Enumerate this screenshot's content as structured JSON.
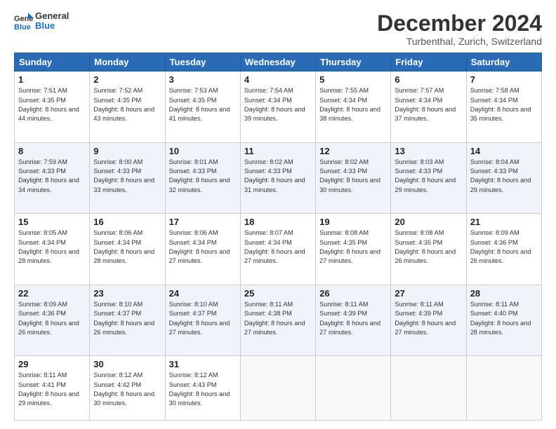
{
  "header": {
    "logo_line1": "General",
    "logo_line2": "Blue",
    "month_title": "December 2024",
    "location": "Turbenthal, Zurich, Switzerland"
  },
  "days_of_week": [
    "Sunday",
    "Monday",
    "Tuesday",
    "Wednesday",
    "Thursday",
    "Friday",
    "Saturday"
  ],
  "weeks": [
    [
      {
        "day": "1",
        "sunrise": "Sunrise: 7:51 AM",
        "sunset": "Sunset: 4:35 PM",
        "daylight": "Daylight: 8 hours and 44 minutes."
      },
      {
        "day": "2",
        "sunrise": "Sunrise: 7:52 AM",
        "sunset": "Sunset: 4:35 PM",
        "daylight": "Daylight: 8 hours and 43 minutes."
      },
      {
        "day": "3",
        "sunrise": "Sunrise: 7:53 AM",
        "sunset": "Sunset: 4:35 PM",
        "daylight": "Daylight: 8 hours and 41 minutes."
      },
      {
        "day": "4",
        "sunrise": "Sunrise: 7:54 AM",
        "sunset": "Sunset: 4:34 PM",
        "daylight": "Daylight: 8 hours and 39 minutes."
      },
      {
        "day": "5",
        "sunrise": "Sunrise: 7:55 AM",
        "sunset": "Sunset: 4:34 PM",
        "daylight": "Daylight: 8 hours and 38 minutes."
      },
      {
        "day": "6",
        "sunrise": "Sunrise: 7:57 AM",
        "sunset": "Sunset: 4:34 PM",
        "daylight": "Daylight: 8 hours and 37 minutes."
      },
      {
        "day": "7",
        "sunrise": "Sunrise: 7:58 AM",
        "sunset": "Sunset: 4:34 PM",
        "daylight": "Daylight: 8 hours and 35 minutes."
      }
    ],
    [
      {
        "day": "8",
        "sunrise": "Sunrise: 7:59 AM",
        "sunset": "Sunset: 4:33 PM",
        "daylight": "Daylight: 8 hours and 34 minutes."
      },
      {
        "day": "9",
        "sunrise": "Sunrise: 8:00 AM",
        "sunset": "Sunset: 4:33 PM",
        "daylight": "Daylight: 8 hours and 33 minutes."
      },
      {
        "day": "10",
        "sunrise": "Sunrise: 8:01 AM",
        "sunset": "Sunset: 4:33 PM",
        "daylight": "Daylight: 8 hours and 32 minutes."
      },
      {
        "day": "11",
        "sunrise": "Sunrise: 8:02 AM",
        "sunset": "Sunset: 4:33 PM",
        "daylight": "Daylight: 8 hours and 31 minutes."
      },
      {
        "day": "12",
        "sunrise": "Sunrise: 8:02 AM",
        "sunset": "Sunset: 4:33 PM",
        "daylight": "Daylight: 8 hours and 30 minutes."
      },
      {
        "day": "13",
        "sunrise": "Sunrise: 8:03 AM",
        "sunset": "Sunset: 4:33 PM",
        "daylight": "Daylight: 8 hours and 29 minutes."
      },
      {
        "day": "14",
        "sunrise": "Sunrise: 8:04 AM",
        "sunset": "Sunset: 4:33 PM",
        "daylight": "Daylight: 8 hours and 29 minutes."
      }
    ],
    [
      {
        "day": "15",
        "sunrise": "Sunrise: 8:05 AM",
        "sunset": "Sunset: 4:34 PM",
        "daylight": "Daylight: 8 hours and 28 minutes."
      },
      {
        "day": "16",
        "sunrise": "Sunrise: 8:06 AM",
        "sunset": "Sunset: 4:34 PM",
        "daylight": "Daylight: 8 hours and 28 minutes."
      },
      {
        "day": "17",
        "sunrise": "Sunrise: 8:06 AM",
        "sunset": "Sunset: 4:34 PM",
        "daylight": "Daylight: 8 hours and 27 minutes."
      },
      {
        "day": "18",
        "sunrise": "Sunrise: 8:07 AM",
        "sunset": "Sunset: 4:34 PM",
        "daylight": "Daylight: 8 hours and 27 minutes."
      },
      {
        "day": "19",
        "sunrise": "Sunrise: 8:08 AM",
        "sunset": "Sunset: 4:35 PM",
        "daylight": "Daylight: 8 hours and 27 minutes."
      },
      {
        "day": "20",
        "sunrise": "Sunrise: 8:08 AM",
        "sunset": "Sunset: 4:35 PM",
        "daylight": "Daylight: 8 hours and 26 minutes."
      },
      {
        "day": "21",
        "sunrise": "Sunrise: 8:09 AM",
        "sunset": "Sunset: 4:36 PM",
        "daylight": "Daylight: 8 hours and 26 minutes."
      }
    ],
    [
      {
        "day": "22",
        "sunrise": "Sunrise: 8:09 AM",
        "sunset": "Sunset: 4:36 PM",
        "daylight": "Daylight: 8 hours and 26 minutes."
      },
      {
        "day": "23",
        "sunrise": "Sunrise: 8:10 AM",
        "sunset": "Sunset: 4:37 PM",
        "daylight": "Daylight: 8 hours and 26 minutes."
      },
      {
        "day": "24",
        "sunrise": "Sunrise: 8:10 AM",
        "sunset": "Sunset: 4:37 PM",
        "daylight": "Daylight: 8 hours and 27 minutes."
      },
      {
        "day": "25",
        "sunrise": "Sunrise: 8:11 AM",
        "sunset": "Sunset: 4:38 PM",
        "daylight": "Daylight: 8 hours and 27 minutes."
      },
      {
        "day": "26",
        "sunrise": "Sunrise: 8:11 AM",
        "sunset": "Sunset: 4:39 PM",
        "daylight": "Daylight: 8 hours and 27 minutes."
      },
      {
        "day": "27",
        "sunrise": "Sunrise: 8:11 AM",
        "sunset": "Sunset: 4:39 PM",
        "daylight": "Daylight: 8 hours and 27 minutes."
      },
      {
        "day": "28",
        "sunrise": "Sunrise: 8:11 AM",
        "sunset": "Sunset: 4:40 PM",
        "daylight": "Daylight: 8 hours and 28 minutes."
      }
    ],
    [
      {
        "day": "29",
        "sunrise": "Sunrise: 8:11 AM",
        "sunset": "Sunset: 4:41 PM",
        "daylight": "Daylight: 8 hours and 29 minutes."
      },
      {
        "day": "30",
        "sunrise": "Sunrise: 8:12 AM",
        "sunset": "Sunset: 4:42 PM",
        "daylight": "Daylight: 8 hours and 30 minutes."
      },
      {
        "day": "31",
        "sunrise": "Sunrise: 8:12 AM",
        "sunset": "Sunset: 4:43 PM",
        "daylight": "Daylight: 8 hours and 30 minutes."
      },
      null,
      null,
      null,
      null
    ]
  ]
}
